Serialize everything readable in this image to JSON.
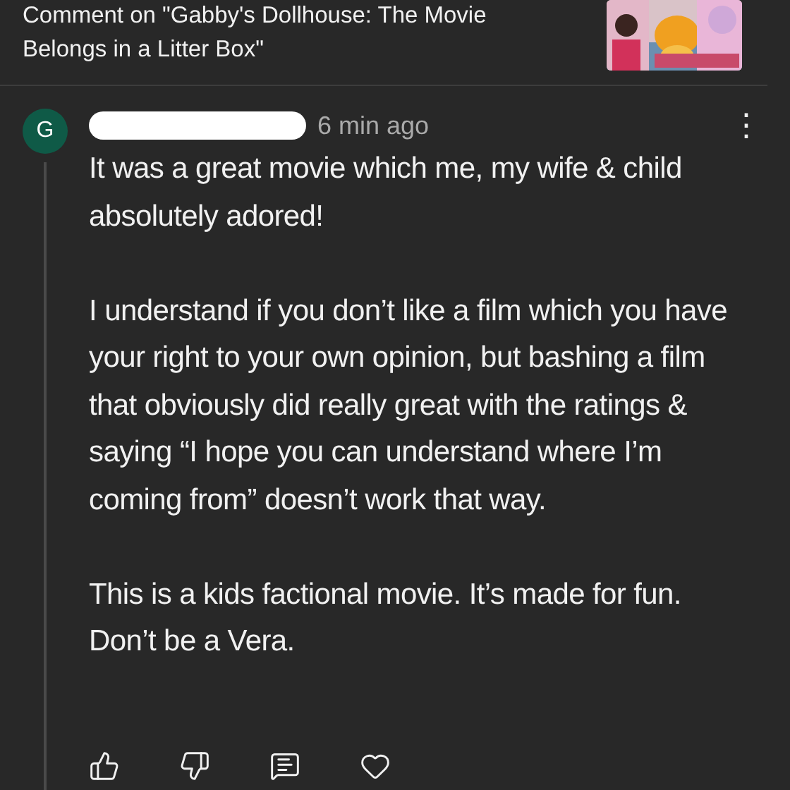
{
  "header": {
    "title": "Comment on \"Gabby's Dollhouse: The Movie Belongs in a Litter Box\""
  },
  "comment": {
    "avatar_letter": "G",
    "time": "6 min ago",
    "more": "⋮",
    "paragraphs": [
      "It was a great movie which me, my wife & child absolutely adored!",
      "I understand if you don’t like a film which you have your right to your own opinion, but bashing a film that obviously did really great with the ratings & saying “I hope you can understand where I’m coming from” doesn’t work that way.",
      "This is a kids factional movie. It’s made for fun. Don’t be a Vera."
    ]
  }
}
